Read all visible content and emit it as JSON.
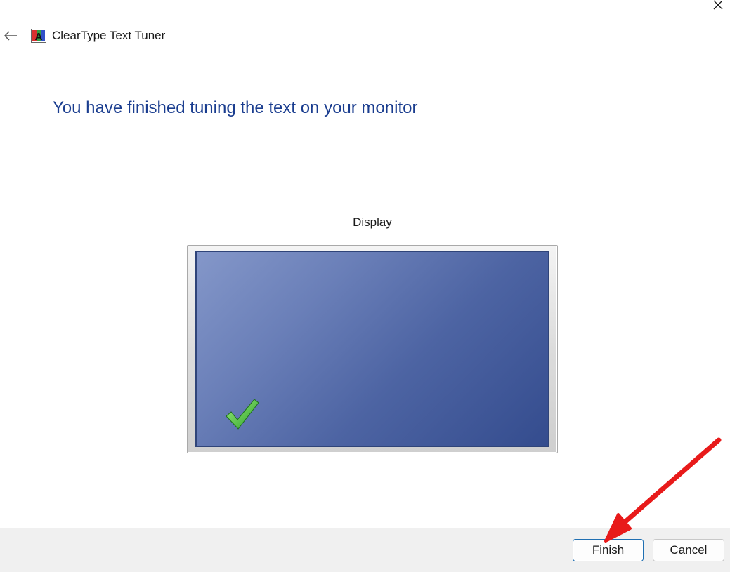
{
  "window": {
    "app_title": "ClearType Text Tuner",
    "icons": {
      "close": "close-icon",
      "back": "back-arrow-icon",
      "app": "cleartype-app-icon"
    }
  },
  "main": {
    "heading": "You have finished tuning the text on your monitor",
    "display_label": "Display",
    "check_icon": "checkmark-icon"
  },
  "footer": {
    "finish_label": "Finish",
    "cancel_label": "Cancel"
  },
  "annotation": {
    "icon": "red-arrow-pointer",
    "color": "#e81a1a"
  },
  "colors": {
    "heading": "#1a3d8f",
    "screen_dark": "#344c8e",
    "screen_light": "#8497c9",
    "focus_border": "#1f6fb2"
  }
}
